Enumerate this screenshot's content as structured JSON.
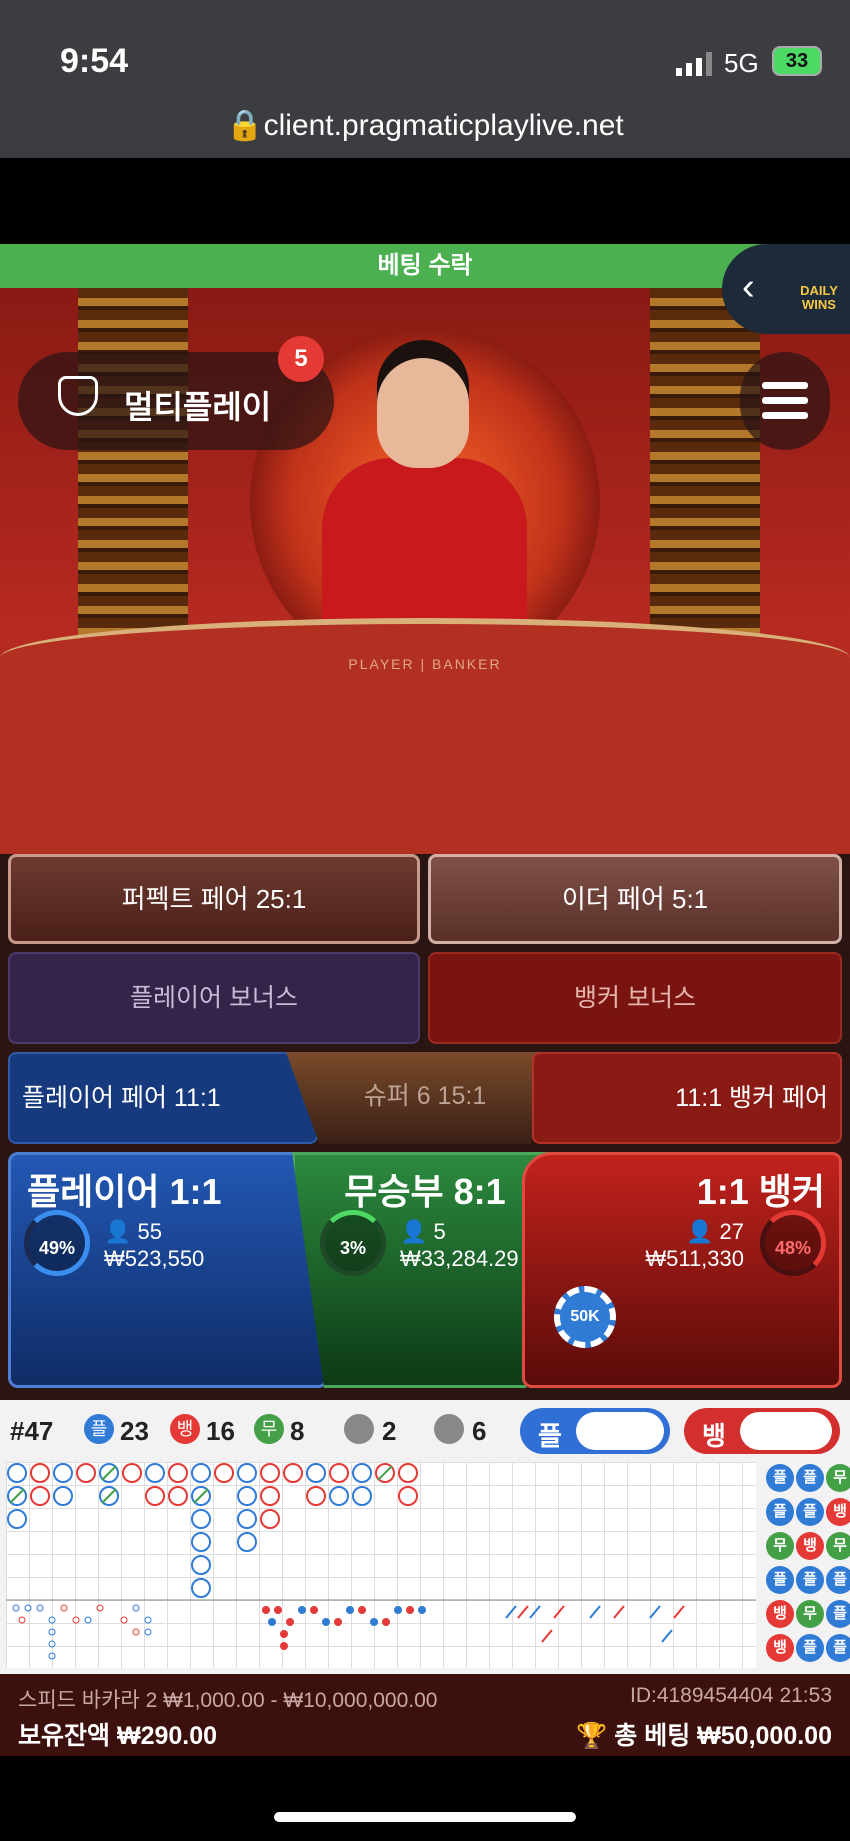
{
  "status_bar": {
    "time": "9:54",
    "network": "5G",
    "battery": "33"
  },
  "browser": {
    "url": "client.pragmaticplaylive.net"
  },
  "banner": {
    "accept": "베팅 수락"
  },
  "daily_wins": {
    "text": "DAILY WINS"
  },
  "multiplay": {
    "label": "멀티플레이",
    "badge": "5"
  },
  "table_print": "PLAYER | BANKER",
  "side_bets": {
    "perfect_pair": "퍼펙트 페어 25:1",
    "either_pair": "이더 페어 5:1",
    "player_bonus": "플레이어 보너스",
    "banker_bonus": "뱅커 보너스",
    "player_pair": "플레이어 페어 11:1",
    "super6": "슈퍼 6 15:1",
    "banker_pair": "11:1 뱅커 페어"
  },
  "main_bets": {
    "player": {
      "label": "플레이어 1:1",
      "pct": "49%",
      "pct_value": 49,
      "users": "55",
      "amount": "₩523,550"
    },
    "tie": {
      "label": "무승부 8:1",
      "pct": "3%",
      "pct_value": 3,
      "users": "5",
      "amount": "₩33,284.29"
    },
    "banker": {
      "label": "1:1 뱅커",
      "pct": "48%",
      "pct_value": 48,
      "users": "27",
      "amount": "₩511,330"
    }
  },
  "chip": {
    "label": "50K"
  },
  "roadmap": {
    "round": "#47",
    "player_glyph": "플",
    "player_count": "23",
    "banker_glyph": "뱅",
    "banker_count": "16",
    "tie_glyph": "무",
    "tie_count": "8",
    "player_pair_count": "2",
    "banker_pair_count": "6",
    "ask_player": "플",
    "ask_banker": "뱅",
    "mini": [
      "플",
      "플",
      "무",
      "플",
      "플",
      "뱅",
      "무",
      "뱅",
      "무",
      "플",
      "플",
      "플",
      "뱅",
      "무",
      "플",
      "뱅",
      "플",
      "플"
    ]
  },
  "footer": {
    "table_info": "스피드 바카라 2 ₩1,000.00 - ₩10,000,000.00",
    "id_time": "ID:4189454404 21:53",
    "balance_label": "보유잔액",
    "balance": "₩290.00",
    "total_bet_label": "총 베팅",
    "total_bet": "₩50,000.00"
  },
  "colors": {
    "player": "#1f4ea3",
    "banker": "#b31c1c",
    "tie": "#1f7a34",
    "accent_green": "#4caf50"
  }
}
